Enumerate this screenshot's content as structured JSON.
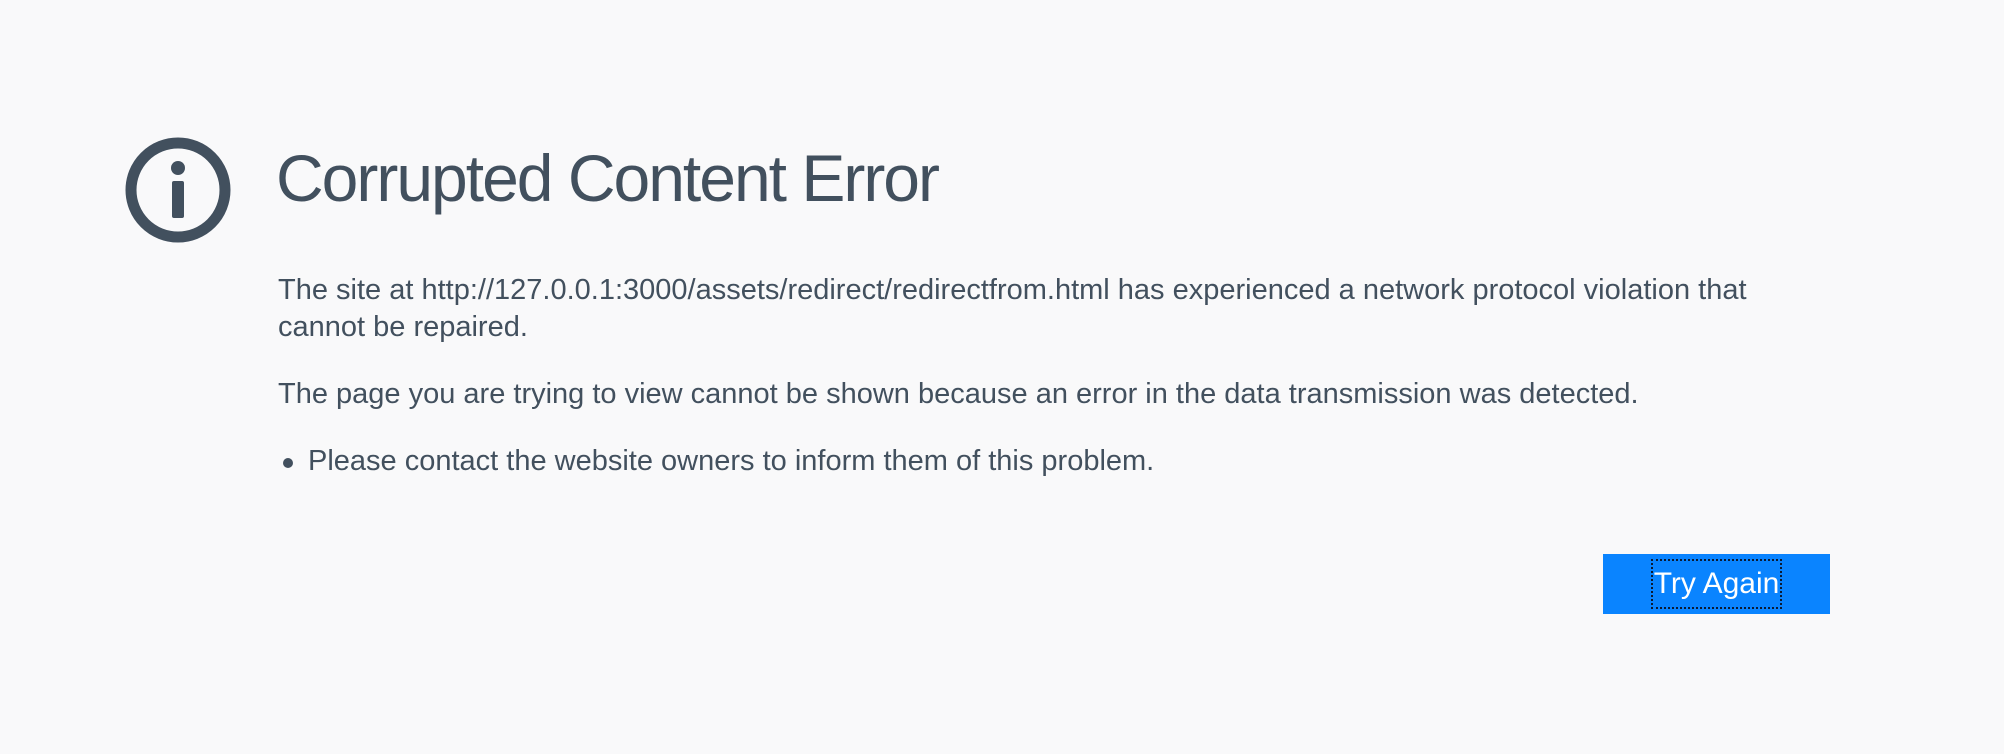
{
  "error": {
    "icon": "info-icon",
    "title": "Corrupted Content Error",
    "description": "The site at http://127.0.0.1:3000/assets/redirect/redirectfrom.html has experienced a network protocol violation that cannot be repaired.",
    "detail": "The page you are trying to view cannot be shown because an error in the data transmission was detected.",
    "suggestions": [
      "Please contact the website owners to inform them of this problem."
    ],
    "button_label": "Try Again"
  },
  "colors": {
    "background": "#f9f9fa",
    "text": "#42505e",
    "button": "#0a84ff",
    "button_text": "#ffffff"
  }
}
